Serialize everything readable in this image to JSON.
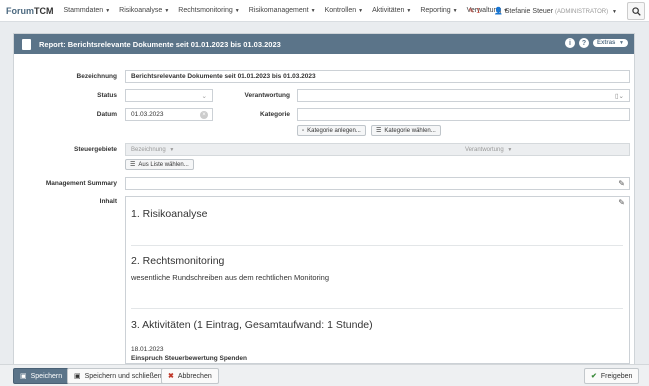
{
  "nav": {
    "brand_a": "Forum",
    "brand_b": "TCM",
    "menu": [
      "Stammdaten",
      "Risikoanalyse",
      "Rechtsmonitoring",
      "Risikomanagement",
      "Kontrollen",
      "Aktivitäten",
      "Reporting",
      "Verwaltung"
    ],
    "edit_count": "1",
    "user": "Stefanie Steuer",
    "role": "(ADMINISTRATOR)"
  },
  "panel": {
    "title": "Report: Berichtsrelevante Dokumente seit 01.01.2023 bis 01.03.2023",
    "info": "i",
    "help": "?",
    "extras": "Extras"
  },
  "form": {
    "bezeichnung_label": "Bezeichnung",
    "bezeichnung_value": "Berichtsrelevante Dokumente seit 01.01.2023 bis 01.03.2023",
    "status_label": "Status",
    "verantwortung_label": "Verantwortung",
    "datum_label": "Datum",
    "datum_value": "01.03.2023",
    "kategorie_label": "Kategorie",
    "kategorie_anlegen": "Kategorie anlegen...",
    "kategorie_waehlen": "Kategorie wählen...",
    "steuergebiete_label": "Steuergebiete",
    "col_bezeichnung": "Bezeichnung",
    "col_verantwortung": "Verantwortung",
    "aus_liste": "Aus Liste wählen...",
    "management_summary_label": "Management Summary",
    "inhalt_label": "Inhalt"
  },
  "content": {
    "h1": "1. Risikoanalyse",
    "h2": "2. Rechtsmonitoring",
    "p2": "wesentliche Rundschreiben aus dem rechtlichen Monitoring",
    "h3": "3. Aktivitäten (1 Eintrag, Gesamtaufwand: 1 Stunde)",
    "date": "18.01.2023",
    "entry": "Einspruch Steuerbewertung Spenden"
  },
  "footer": {
    "save": "Speichern",
    "save_close": "Speichern und schließen",
    "cancel": "Abbrechen",
    "release": "Freigeben"
  },
  "colors": {
    "accent": "#5b7489",
    "cancel": "#c0392b",
    "release": "#3a8a3a"
  }
}
